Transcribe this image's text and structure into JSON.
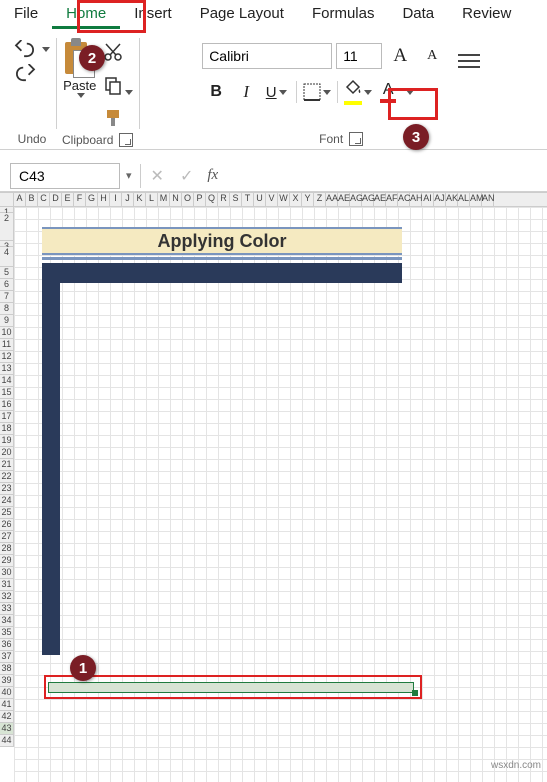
{
  "tabs": {
    "file": "File",
    "home": "Home",
    "insert": "Insert",
    "page_layout": "Page Layout",
    "formulas": "Formulas",
    "data": "Data",
    "review": "Review"
  },
  "ribbon": {
    "undo_label": "Undo",
    "clipboard_label": "Clipboard",
    "paste_label": "Paste",
    "font_label": "Font",
    "font_name": "Calibri",
    "font_size": "11",
    "increase_font": "A",
    "decrease_font": "A",
    "bold": "B",
    "italic": "I",
    "underline": "U",
    "fontcolor": "A"
  },
  "namebox": "C43",
  "fx": "fx",
  "sheet": {
    "title": "Applying Color",
    "cols": [
      "A",
      "B",
      "C",
      "D",
      "E",
      "F",
      "G",
      "H",
      "I",
      "J",
      "K",
      "L",
      "M",
      "N",
      "O",
      "P",
      "Q",
      "R",
      "S",
      "T",
      "U",
      "V",
      "W",
      "X",
      "Y",
      "Z",
      "AA",
      "AE",
      "AG",
      "AG",
      "AE",
      "AF",
      "AC",
      "AH",
      "AI",
      "AJ",
      "AK",
      "AL",
      "AM",
      "AN"
    ],
    "rows": [
      "1",
      "2",
      "3",
      "4",
      "5",
      "6",
      "7",
      "8",
      "9",
      "10",
      "11",
      "12",
      "13",
      "14",
      "15",
      "16",
      "17",
      "18",
      "19",
      "20",
      "21",
      "22",
      "23",
      "24",
      "25",
      "26",
      "27",
      "28",
      "29",
      "30",
      "31",
      "32",
      "33",
      "34",
      "35",
      "36",
      "37",
      "38",
      "39",
      "40",
      "41",
      "42",
      "43",
      "44"
    ]
  },
  "badges": {
    "b1": "1",
    "b2": "2",
    "b3": "3"
  },
  "watermark": "wsxdn.com",
  "colors": {
    "accent": "#0f7b3f",
    "callout": "#d22",
    "fill_bar": "#2a3a5a",
    "title_band": "#f5eac1"
  }
}
